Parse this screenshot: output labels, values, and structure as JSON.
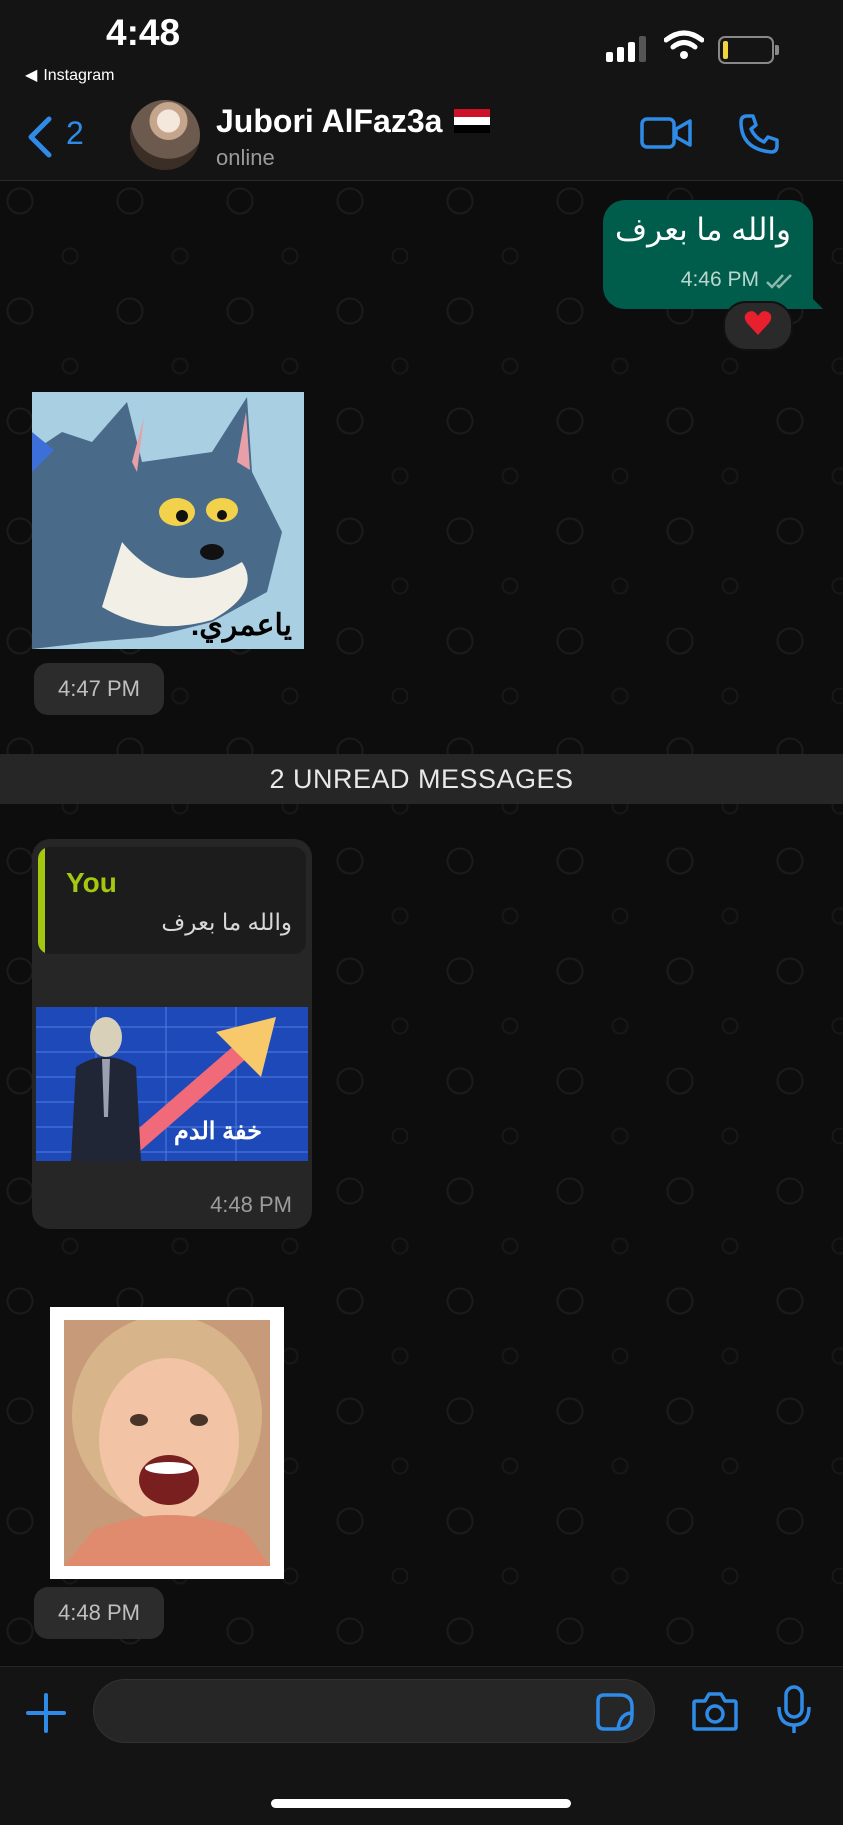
{
  "status_bar": {
    "time": "4:48",
    "back_app": "Instagram",
    "signal_icon": "signal-bars-icon",
    "wifi_icon": "wifi-icon",
    "battery_icon": "battery-low-icon",
    "battery_level": 0.1
  },
  "header": {
    "back_count": "2",
    "contact_name": "Jubori AlFaz3a",
    "flag_icon": "iraq-flag-icon",
    "status": "online",
    "video_icon": "video-call-icon",
    "phone_icon": "phone-call-icon",
    "accent_color": "#2e8be8"
  },
  "messages": {
    "outgoing_1": {
      "text": "والله ما بعرف",
      "time": "4:46 PM",
      "status_icon": "double-check-icon",
      "reaction_icon": "heart-icon",
      "bubble_color": "#005c4b"
    },
    "sticker_1": {
      "caption": "ياعمري.",
      "time": "4:47 PM"
    },
    "unread_divider": "2 UNREAD MESSAGES",
    "reply_1": {
      "quote_author": "You",
      "quote_text": "والله ما بعرف",
      "meme_caption": "خفة الدم",
      "time": "4:48 PM",
      "quote_color": "#a4c70f"
    },
    "sticker_2": {
      "time": "4:48 PM"
    }
  },
  "input_bar": {
    "plus_icon": "plus-icon",
    "placeholder": "",
    "sticker_icon": "sticker-icon",
    "camera_icon": "camera-icon",
    "mic_icon": "microphone-icon"
  }
}
